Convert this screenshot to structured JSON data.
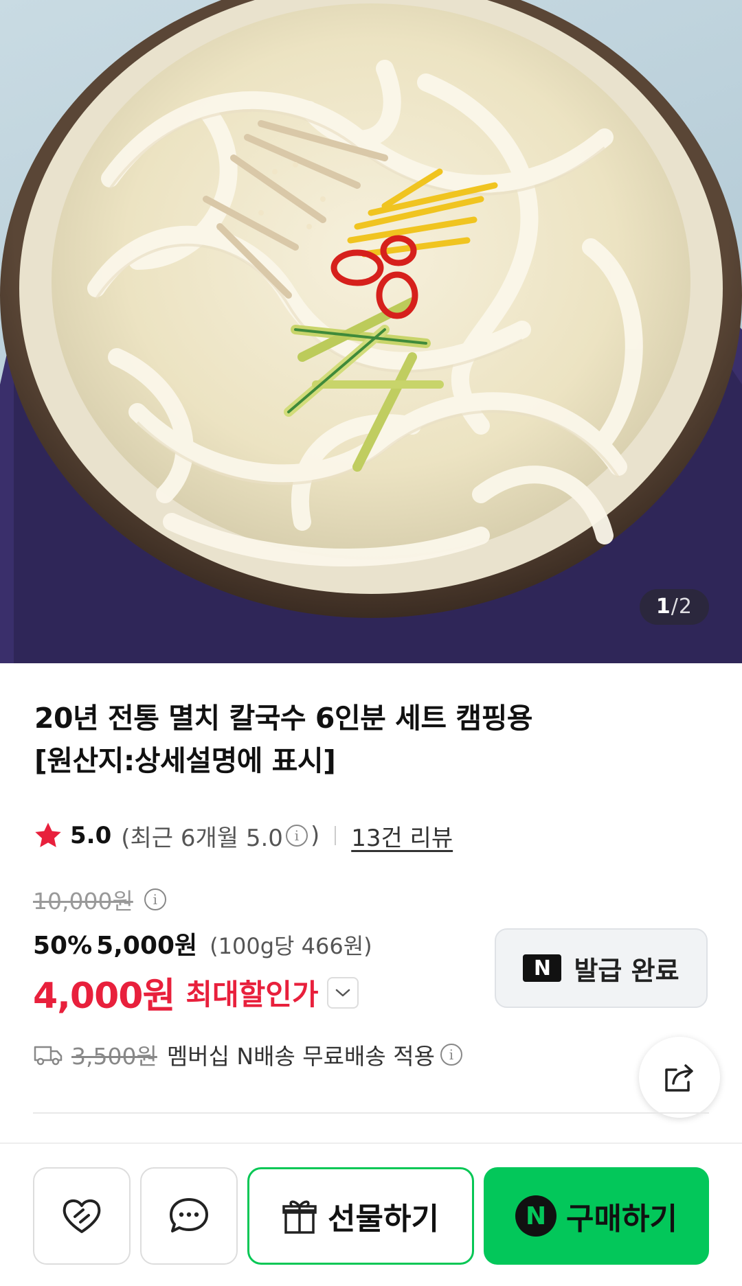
{
  "gallery": {
    "current": "1",
    "separator": "/",
    "total": "2"
  },
  "product": {
    "title_line1": "20년 전통 멸치 칼국수 6인분 세트 캠핑용",
    "title_line2": "[원산지:상세설명에 표시]"
  },
  "rating": {
    "icon": "star-icon",
    "score": "5.0",
    "recent_label": "(최근 6개월 5.0",
    "recent_close": ")",
    "reviews": "13건 리뷰"
  },
  "price": {
    "original": "10,000원",
    "discount_pct": "50%",
    "sale": "5,000원",
    "unit_price": "(100g당 466원)",
    "max_discount_price": "4,000원",
    "max_discount_label": "최대할인가"
  },
  "coupon": {
    "badge": "N",
    "label": "발급 완료"
  },
  "shipping": {
    "fee": "3,500원",
    "text": "멤버십 N배송 무료배송 적용"
  },
  "actions": {
    "gift_label": "선물하기",
    "buy_badge": "N",
    "buy_label": "구매하기"
  },
  "colors": {
    "accent_red": "#e8203c",
    "naver_green": "#03c75a"
  }
}
